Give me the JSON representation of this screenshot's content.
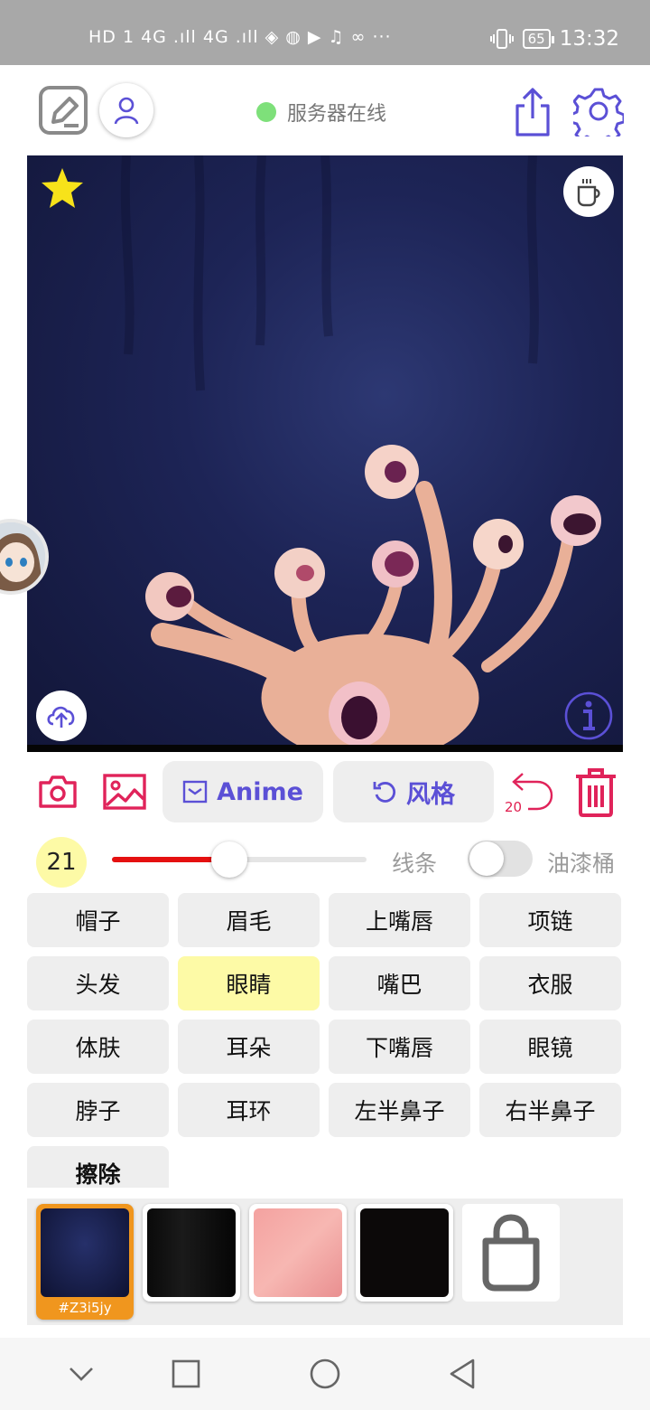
{
  "status_bar": {
    "left_icons": "HD 1 4G .ıll 4G .ıll ◈ ◍ ▶ ♫ ∞ ···",
    "battery": "65",
    "time": "13:32"
  },
  "topbar": {
    "server_status": "服务器在线",
    "server_status_color": "#7ee07a"
  },
  "tools": {
    "style_model_label": "Anime",
    "style_button_label": "风格",
    "undo_count": "20"
  },
  "brush": {
    "size": "21",
    "slider_fraction": 0.46,
    "line_label": "线条",
    "bucket_label": "油漆桶",
    "bucket_enabled": false
  },
  "parts": [
    {
      "label": "帽子"
    },
    {
      "label": "眉毛"
    },
    {
      "label": "上嘴唇"
    },
    {
      "label": "项链"
    },
    {
      "label": "头发"
    },
    {
      "label": "眼睛"
    },
    {
      "label": "嘴巴"
    },
    {
      "label": "衣服"
    },
    {
      "label": "体肤"
    },
    {
      "label": "耳朵"
    },
    {
      "label": "下嘴唇"
    },
    {
      "label": "眼镜"
    },
    {
      "label": "脖子"
    },
    {
      "label": "耳环"
    },
    {
      "label": "左半鼻子"
    },
    {
      "label": "右半鼻子"
    },
    {
      "label": "擦除"
    }
  ],
  "selected_part": "眼睛",
  "gallery": {
    "items": [
      {
        "tag": "#Z3i5jy",
        "selected": true
      },
      {
        "tag": "",
        "selected": false
      },
      {
        "tag": "",
        "selected": false
      },
      {
        "tag": "",
        "selected": false
      }
    ]
  },
  "colors": {
    "accent_purple": "#5b50d6",
    "accent_red": "#e0235a",
    "slider_red": "#e51010",
    "highlight_yellow": "#fdfaa6"
  }
}
